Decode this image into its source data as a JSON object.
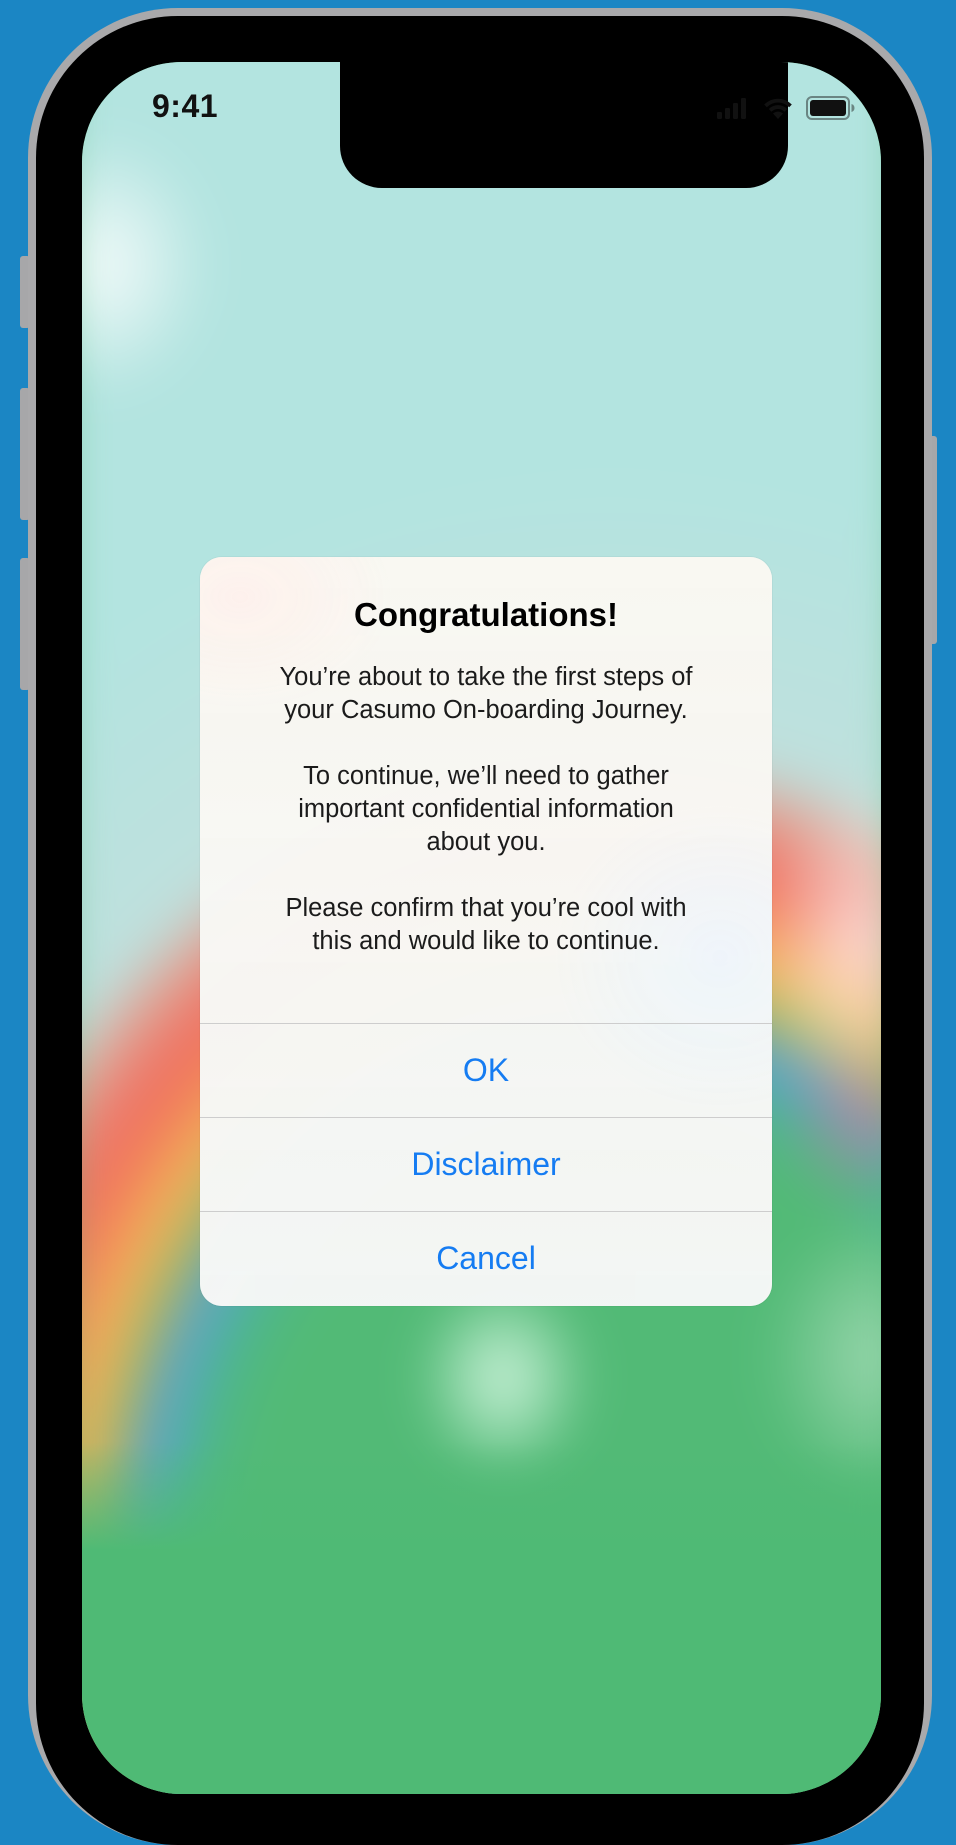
{
  "status_bar": {
    "time": "9:41",
    "icons": [
      "signal-icon",
      "wifi-icon",
      "battery-icon"
    ]
  },
  "alert": {
    "title": "Congratulations!",
    "paragraphs": [
      "You’re about to take the first steps of\nyour Casumo On-boarding Journey.",
      "To continue, we’ll need to gather\nimportant confidential information\nabout you.",
      "Please confirm that you’re cool with\nthis and would like to continue."
    ],
    "buttons": {
      "ok_label": "OK",
      "disclaimer_label": "Disclaimer",
      "cancel_label": "Cancel"
    }
  },
  "colors": {
    "background": "#1b86c4",
    "accent": "#157cf2",
    "alert_surface": "#f8f8f8"
  }
}
